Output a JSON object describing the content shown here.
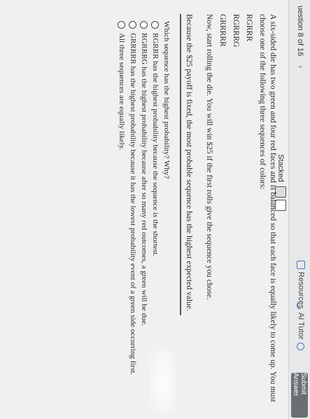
{
  "header": {
    "question_label": "uestion 8 of 16",
    "chevron": "›",
    "resources_label": "Resources",
    "ai_tutor_label": "AI Tutor",
    "submit_label": "Submit Answer"
  },
  "view": {
    "mode_label": "Stacked"
  },
  "problem": {
    "intro": "A six-sided die has two green and four red faces and is balanced so that each face is equally likely to come up. You must choose one of the following three sequences of colors:",
    "sequences": [
      "RGRRR",
      "RGRRRG",
      "GRRRRR"
    ],
    "instruction": "Now, start rolling the die. You will win $25 if the first rolls give the sequence you chose.",
    "note": "Because the $25 payoff is fixed, the most probable sequence has the highest expected value."
  },
  "question": {
    "prompt": "Which sequence has the highest probability? Why?",
    "options": [
      "RGRRR has the highest probability because the sequence is the shortest.",
      "RGRRRG has the highest probability because after so many red outcomes, a green will be due.",
      "GRRRRR has the highest probability because it has the lowest probability event of a green side occurring first.",
      "All three sequences are equally likely."
    ]
  }
}
